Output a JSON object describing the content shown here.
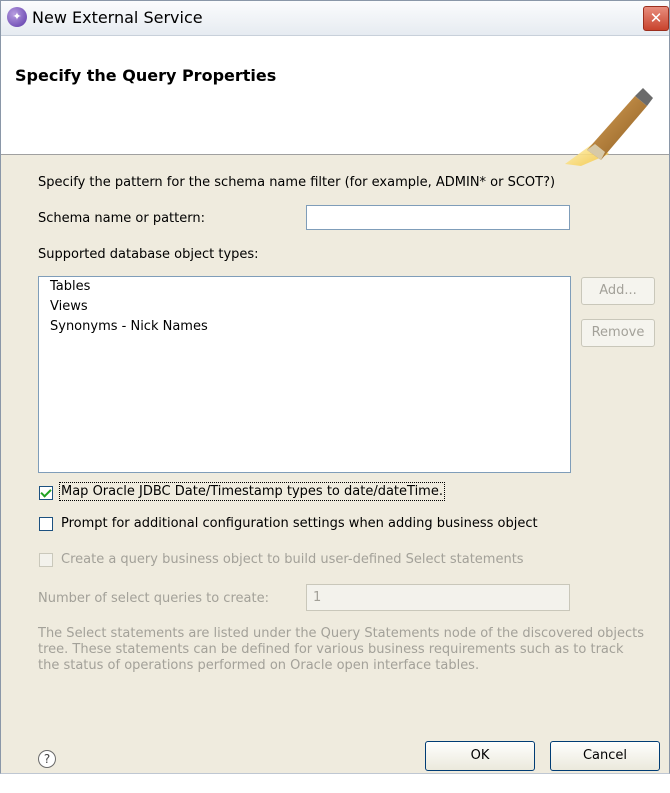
{
  "window": {
    "title": "New External Service",
    "close_glyph": "✕",
    "title_icon": "wizard-icon"
  },
  "banner": {
    "title": "Specify the Query Properties",
    "icon": "magic-wand-icon"
  },
  "form": {
    "pattern_instruction": "Specify the pattern for the schema name filter (for example, ADMIN* or SCOT?)",
    "schema_label": "Schema name or pattern:",
    "schema_value": "",
    "object_types_label": "Supported database object types:",
    "object_types": [
      "Tables",
      "Views",
      "Synonyms - Nick Names"
    ],
    "add_button": "Add...",
    "remove_button": "Remove",
    "map_oracle_label": "Map Oracle JDBC Date/Timestamp types to date/dateTime.",
    "map_oracle_checked": true,
    "prompt_label": "Prompt for additional configuration settings when adding business object",
    "prompt_checked": false,
    "create_query_label": "Create a query business object to build user-defined Select statements",
    "create_query_checked": false,
    "num_queries_label": "Number of select queries to create:",
    "num_queries_value": "1",
    "note": "The Select statements are listed under the Query Statements node of the discovered objects tree. These statements can be defined for various business requirements such as to track the status of operations performed on Oracle open interface tables."
  },
  "footer": {
    "help_glyph": "?",
    "ok_button": "OK",
    "cancel_button": "Cancel"
  }
}
